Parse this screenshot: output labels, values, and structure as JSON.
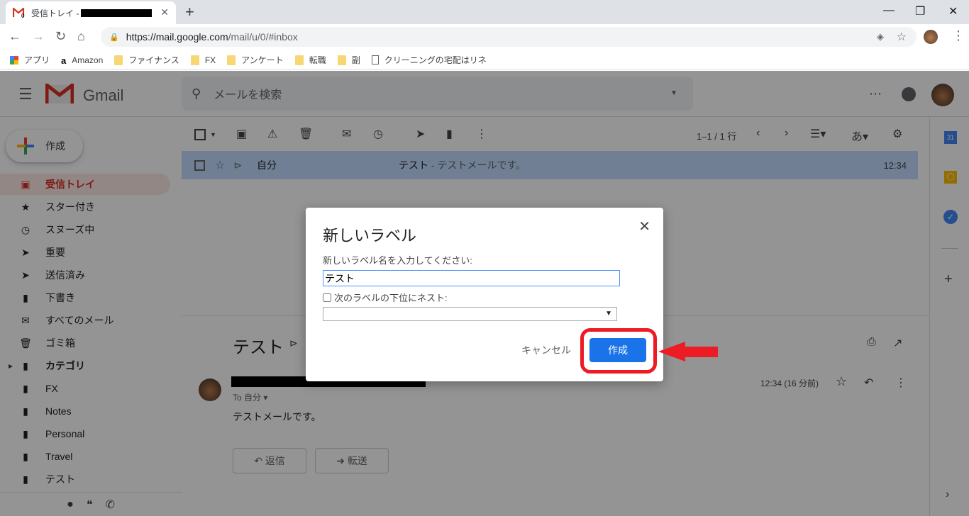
{
  "browser": {
    "tab_title": "受信トレイ -",
    "tab_favicon_badge": "0",
    "url_host": "https://mail.google.com",
    "url_path": "/mail/u/0/#inbox",
    "bookmarks": [
      {
        "label": "アプリ",
        "icon": "apps-grid-icon"
      },
      {
        "label": "Amazon",
        "icon": "amazon-icon"
      },
      {
        "label": "ファイナンス",
        "icon": "folder-icon"
      },
      {
        "label": "FX",
        "icon": "folder-icon"
      },
      {
        "label": "アンケート",
        "icon": "folder-icon"
      },
      {
        "label": "転職",
        "icon": "folder-icon"
      },
      {
        "label": "副",
        "icon": "folder-icon"
      },
      {
        "label": "クリーニングの宅配はリネ",
        "icon": "page-icon"
      }
    ]
  },
  "gmail": {
    "brand": "Gmail",
    "search_placeholder": "メールを検索",
    "compose_label": "作成",
    "nav": [
      {
        "label": "受信トレイ",
        "icon": "inbox-icon",
        "active": true
      },
      {
        "label": "スター付き",
        "icon": "star-icon"
      },
      {
        "label": "スヌーズ中",
        "icon": "clock-icon"
      },
      {
        "label": "重要",
        "icon": "important-icon"
      },
      {
        "label": "送信済み",
        "icon": "send-icon"
      },
      {
        "label": "下書き",
        "icon": "draft-icon"
      },
      {
        "label": "すべてのメール",
        "icon": "mail-icon"
      },
      {
        "label": "ゴミ箱",
        "icon": "trash-icon"
      },
      {
        "label": "カテゴリ",
        "icon": "label-icon",
        "bold": true
      },
      {
        "label": "FX",
        "icon": "label-icon"
      },
      {
        "label": "Notes",
        "icon": "label-icon"
      },
      {
        "label": "Personal",
        "icon": "label-icon"
      },
      {
        "label": "Travel",
        "icon": "label-icon"
      },
      {
        "label": "テスト",
        "icon": "label-icon"
      }
    ],
    "pagination": "1–1 / 1 行",
    "input_tool": "あ",
    "message_row": {
      "sender": "自分",
      "subject": "テスト",
      "snippet": " - テストメールです。",
      "time": "12:34"
    },
    "reading": {
      "subject": "テスト",
      "to": "To 自分",
      "time": "12:34 (16 分前)",
      "body": "テストメールです。",
      "reply_label": "返信",
      "forward_label": "転送"
    },
    "calendar_day": "31"
  },
  "dialog": {
    "title": "新しいラベル",
    "prompt": "新しいラベル名を入力してください:",
    "input_value": "テスト",
    "nest_label": "次のラベルの下位にネスト:",
    "nest_checked": false,
    "cancel_label": "キャンセル",
    "create_label": "作成"
  },
  "annotation": {
    "highlight_color": "#ed1c24"
  },
  "colors": {
    "primary_blue": "#1a73e8",
    "gmail_red": "#d93025",
    "selected_row": "#c2dbff"
  }
}
